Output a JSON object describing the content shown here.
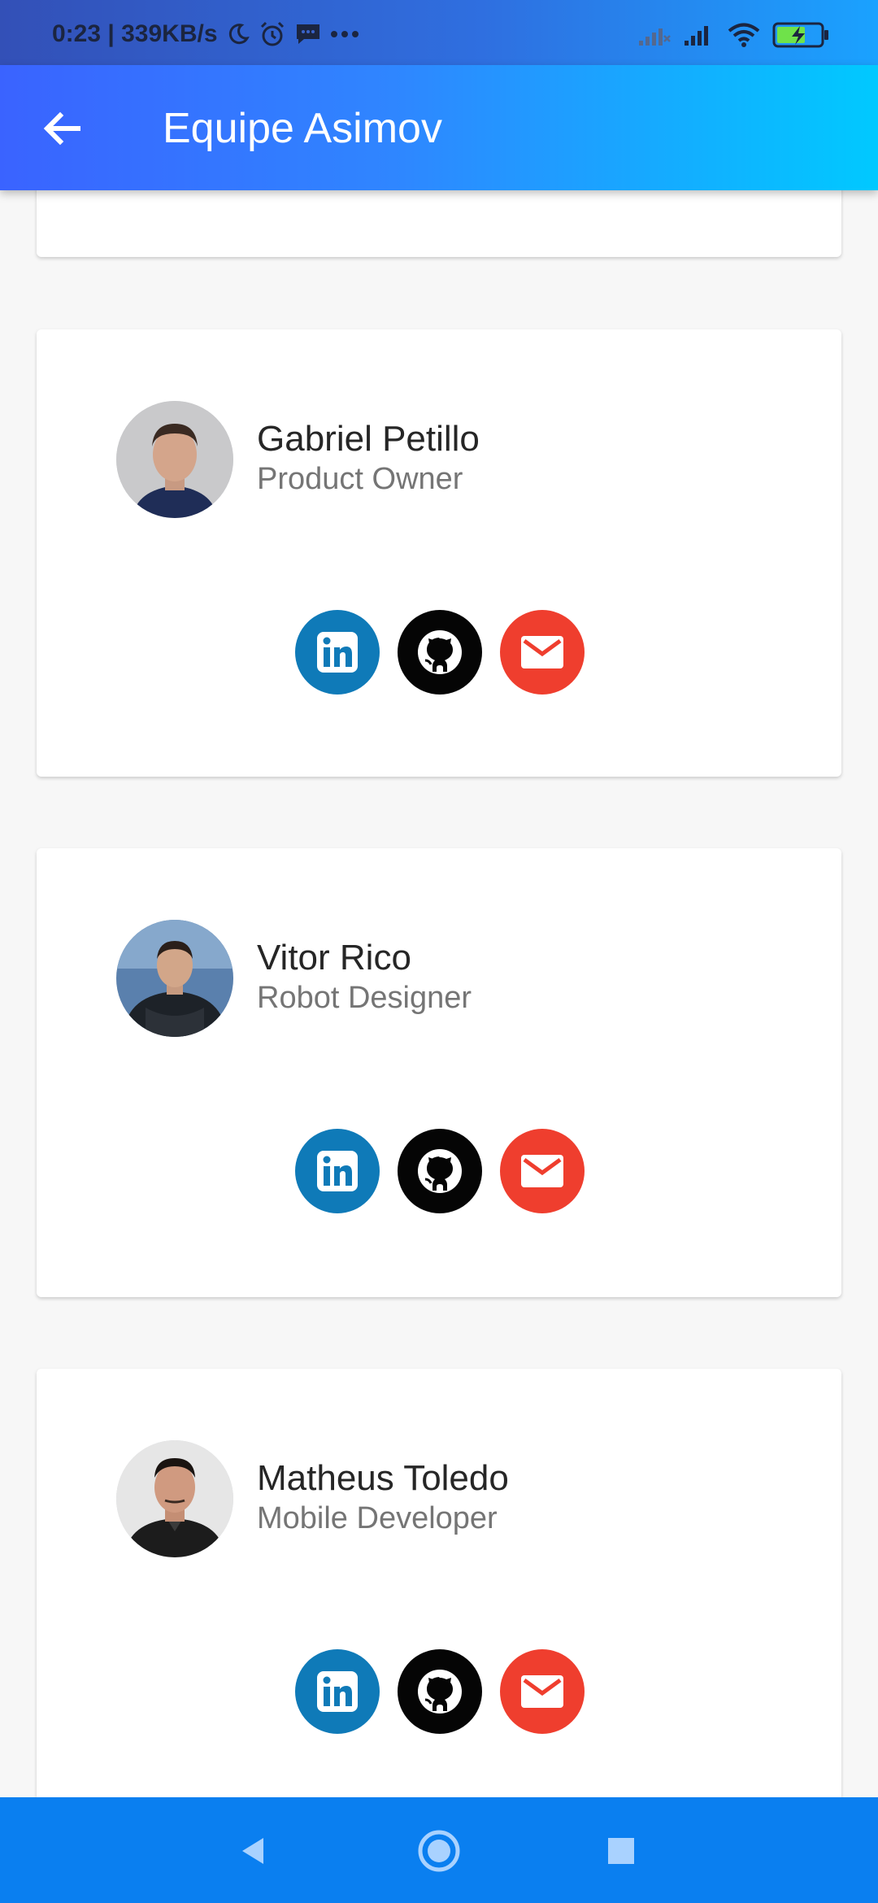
{
  "status_bar": {
    "time_speed": "0:23 | 339KB/s",
    "icons": [
      "moon-icon",
      "alarm-icon",
      "message-icon",
      "more-dots-icon",
      "signal-x-icon",
      "signal-icon",
      "wifi-icon",
      "battery-charging-icon"
    ]
  },
  "app_bar": {
    "title": "Equipe Asimov",
    "back_icon": "arrow-left-icon"
  },
  "members": [
    {
      "name": "Gabriel Petillo",
      "role": "Product Owner"
    },
    {
      "name": "Vitor Rico",
      "role": "Robot Designer"
    },
    {
      "name": "Matheus Toledo",
      "role": "Mobile Developer"
    }
  ],
  "social_colors": {
    "linkedin": "#0f7ab8",
    "github": "#050505",
    "email": "#ef3e2e"
  },
  "nav_bar": {
    "icons": [
      "back-triangle-icon",
      "home-circle-icon",
      "recents-square-icon"
    ]
  }
}
